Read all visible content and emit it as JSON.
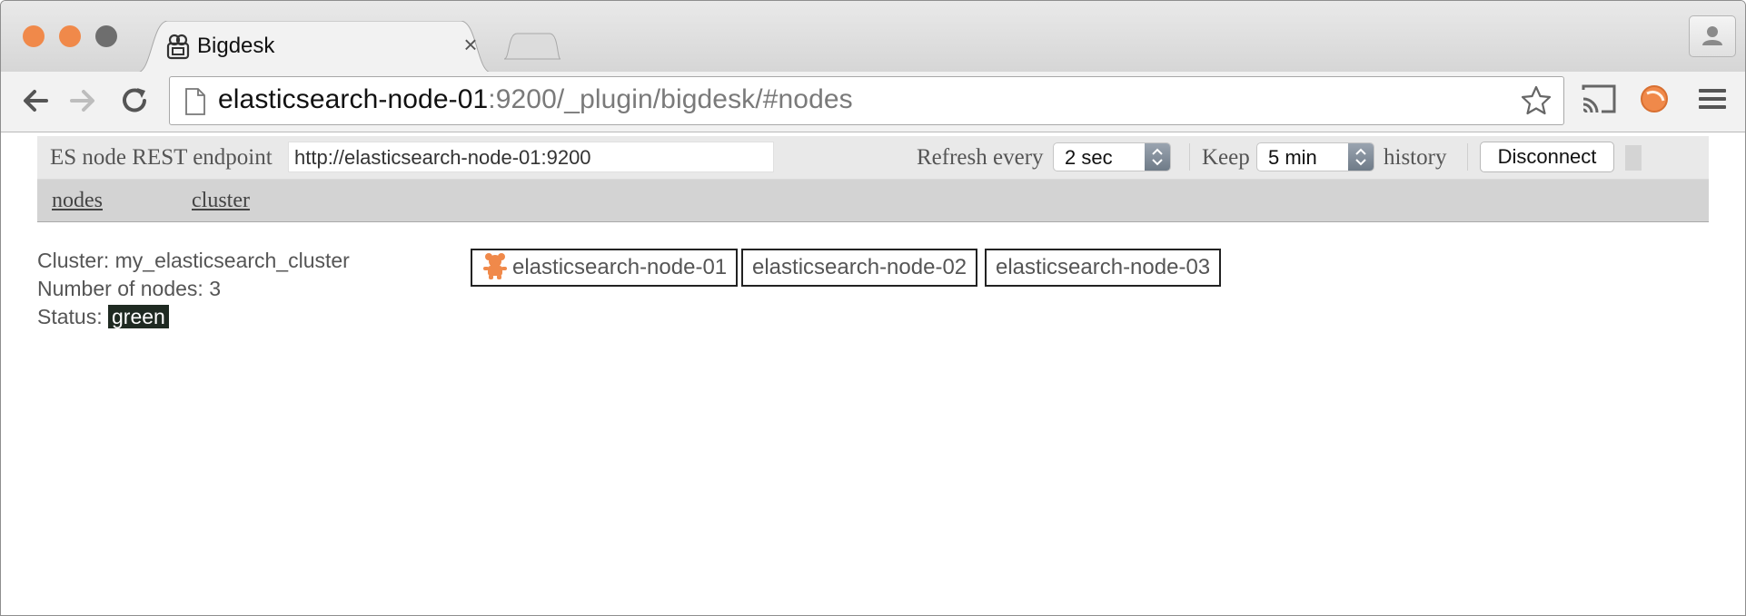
{
  "browser": {
    "tab": {
      "title": "Bigdesk",
      "close": "×"
    },
    "url": {
      "host": "elasticsearch-node-01",
      "rest": ":9200/_plugin/bigdesk/#nodes"
    }
  },
  "config": {
    "endpoint_label": "ES node REST endpoint",
    "endpoint_value": "http://elasticsearch-node-01:9200",
    "refresh_label": "Refresh every",
    "refresh_value": "2 sec",
    "keep_label": "Keep",
    "keep_value": "5 min",
    "history_label": "history",
    "disconnect_label": "Disconnect"
  },
  "nav": {
    "nodes": "nodes",
    "cluster": "cluster"
  },
  "cluster": {
    "name_line": "Cluster: my_elasticsearch_cluster",
    "nodes_line": "Number of nodes: 3",
    "status_label": "Status:",
    "status_value": "green"
  },
  "nodes": [
    {
      "name": "elasticsearch-node-01",
      "master": true
    },
    {
      "name": "elasticsearch-node-02",
      "master": false
    },
    {
      "name": "elasticsearch-node-03",
      "master": false
    }
  ],
  "colors": {
    "traffic_light": "#f0894a",
    "status_badge_bg": "#1f2a22",
    "master_icon": "#f0894a"
  },
  "icons": [
    "back-arrow-icon",
    "forward-arrow-icon",
    "reload-icon",
    "page-icon",
    "star-icon",
    "cast-icon",
    "extension-icon",
    "menu-icon",
    "profile-icon",
    "master-node-icon"
  ]
}
